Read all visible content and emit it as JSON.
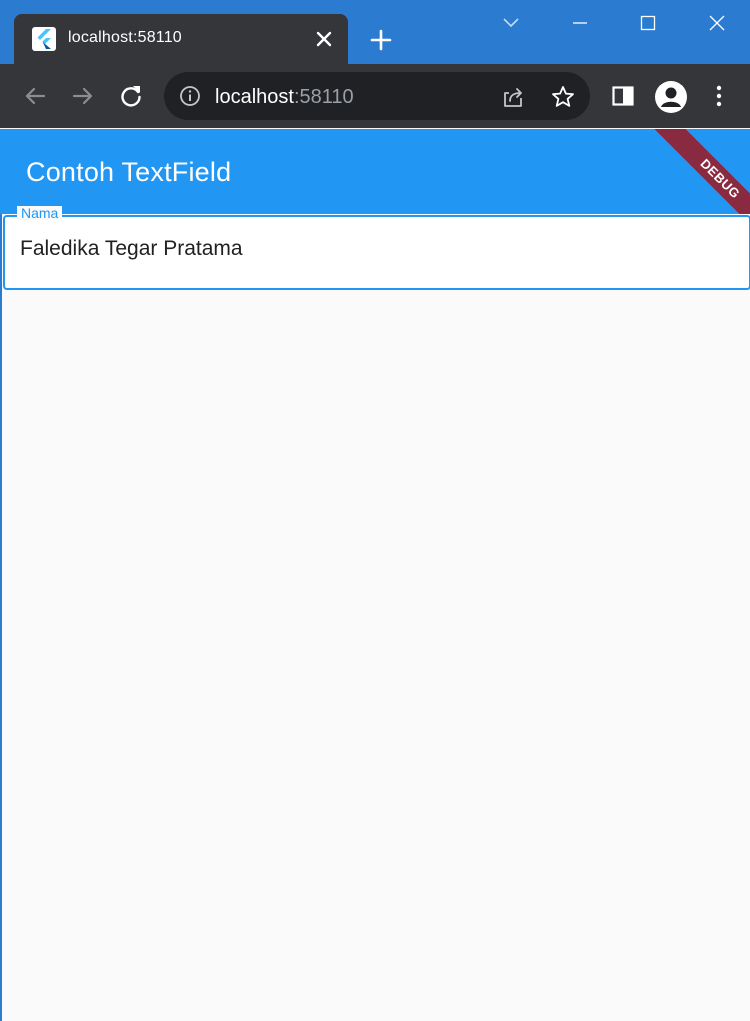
{
  "browser": {
    "tab": {
      "title": "localhost:58110",
      "favicon": "flutter-icon"
    },
    "address_bar": {
      "host": "localhost",
      "port": ":58110"
    },
    "colors": {
      "titlebar": "#2b7bd0",
      "toolbar": "#35363a",
      "omnibox": "#202124"
    }
  },
  "app": {
    "appbar": {
      "title": "Contoh TextField",
      "color": "#2196f3"
    },
    "debug_banner": "DEBUG",
    "textfield": {
      "label": "Nama",
      "value": "Faledika Tegar Pratama"
    }
  }
}
